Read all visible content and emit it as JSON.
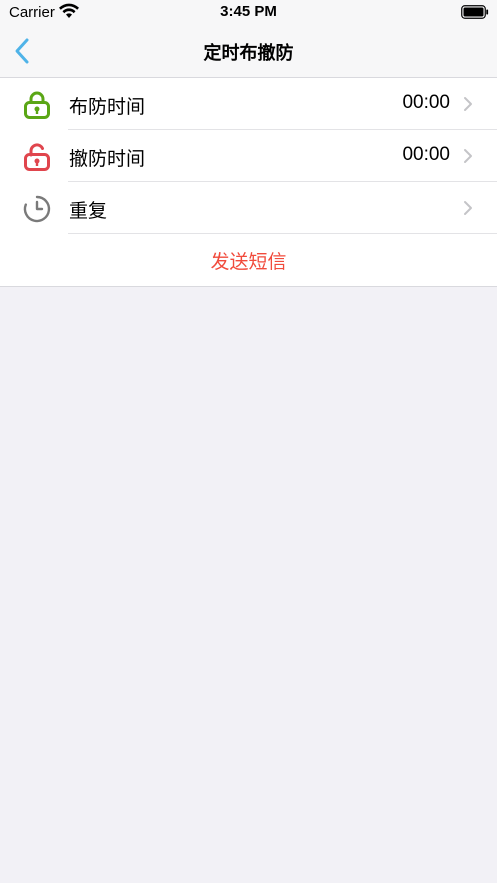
{
  "status_bar": {
    "carrier": "Carrier",
    "time": "3:45 PM",
    "wifi_icon": "wifi-icon",
    "battery_icon": "battery-icon"
  },
  "nav": {
    "title": "定时布撤防",
    "back_icon": "chevron-left-icon",
    "accent_color": "#4fb3e8"
  },
  "rows": [
    {
      "icon": "lock-closed-icon",
      "icon_color": "#5aa615",
      "label": "布防时间",
      "value": "00:00"
    },
    {
      "icon": "lock-open-icon",
      "icon_color": "#e0454d",
      "label": "撤防时间",
      "value": "00:00"
    },
    {
      "icon": "clock-icon",
      "icon_color": "#7a7a7a",
      "label": "重复",
      "value": ""
    }
  ],
  "action": {
    "label": "发送短信",
    "color": "#f14b3c"
  }
}
